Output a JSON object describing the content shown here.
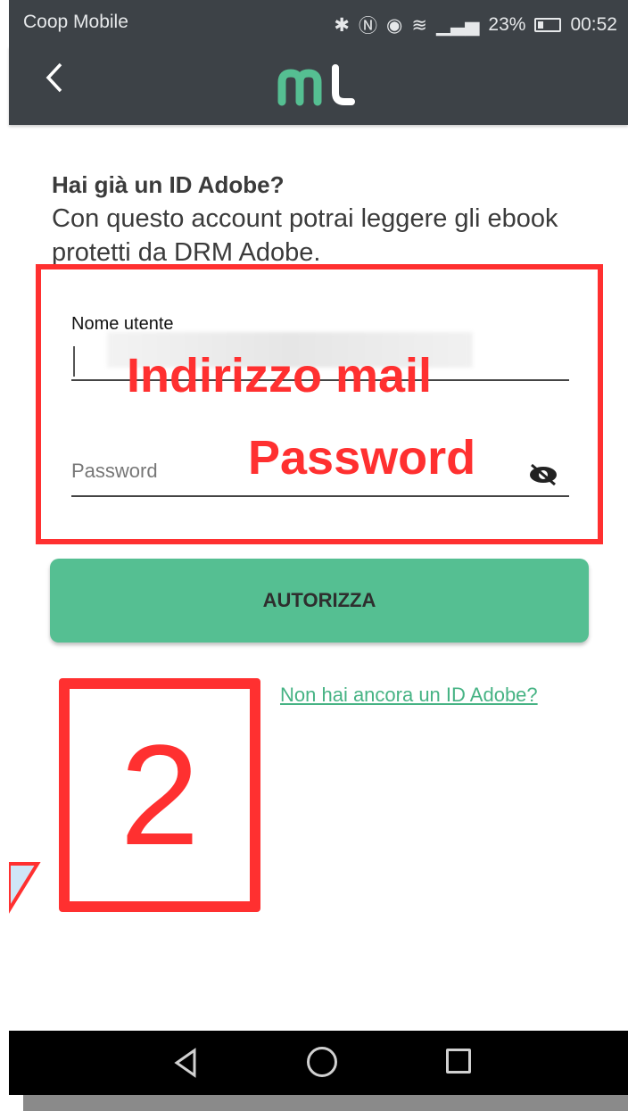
{
  "status_bar": {
    "carrier": "Coop Mobile",
    "icons": [
      "bluetooth-icon",
      "nfc-icon",
      "eye-comfort-icon",
      "wifi-icon",
      "signal-icon",
      "battery-icon"
    ],
    "battery": "23%",
    "time": "00:52"
  },
  "app_bar": {
    "back_icon": "chevron-left-icon",
    "logo": "ml",
    "logo_colors": {
      "m": "#55bf92",
      "l": "#ffffff"
    }
  },
  "form": {
    "heading": "Hai già un ID Adobe?",
    "description": "Con questo account potrai leggere gli ebook protetti da DRM Adobe.",
    "username_label": "Nome utente",
    "password_placeholder": "Password",
    "authorize_label": "AUTORIZZA",
    "signup_link": "Non hai ancora un ID Adobe?"
  },
  "annotations": {
    "email_hint": "Indirizzo mail",
    "password_hint": "Password",
    "step_number": "2",
    "color": "#ff3030"
  },
  "nav_bar": {
    "icons": [
      "nav-back-icon",
      "nav-home-icon",
      "nav-recent-icon"
    ]
  },
  "colors": {
    "bar": "#3d4247",
    "accent": "#55bf92",
    "link": "#46b384"
  }
}
